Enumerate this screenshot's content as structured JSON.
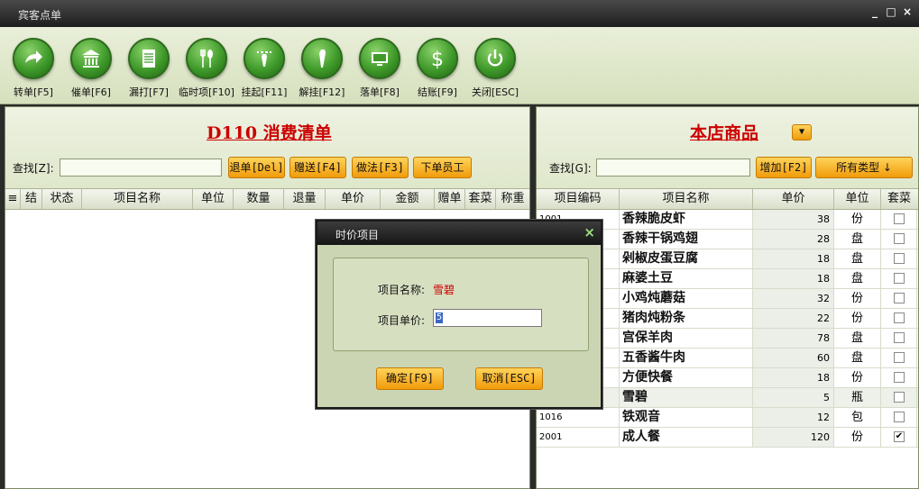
{
  "window": {
    "title": "宾客点单",
    "minimize": "_",
    "maximize": "□",
    "close": "×"
  },
  "toolbar": [
    {
      "label": "转单[F5]",
      "icon": "forward-arrow-icon"
    },
    {
      "label": "催单[F6]",
      "icon": "bank-icon"
    },
    {
      "label": "漏打[F7]",
      "icon": "document-icon"
    },
    {
      "label": "临时项[F10]",
      "icon": "fork-spoon-icon"
    },
    {
      "label": "挂起[F11]",
      "icon": "tie-icon"
    },
    {
      "label": "解挂[F12]",
      "icon": "tie-loose-icon"
    },
    {
      "label": "落单[F8]",
      "icon": "monitor-icon"
    },
    {
      "label": "结账[F9]",
      "icon": "dollar-icon"
    },
    {
      "label": "关闭[ESC]",
      "icon": "power-icon"
    }
  ],
  "left_panel": {
    "title": "D110  消费清单",
    "search_label": "查找[Z]:",
    "search_value": "",
    "buttons": [
      "退单[Del]",
      "赠送[F4]",
      "做法[F3]",
      "下单员工"
    ],
    "columns": [
      "≡",
      "结",
      "状态",
      "项目名称",
      "单位",
      "数量",
      "退量",
      "单价",
      "金额",
      "赠单",
      "套菜",
      "称重"
    ]
  },
  "right_panel": {
    "title": "本店商品",
    "dropdown_icon": "▼",
    "search_label": "查找[G]:",
    "search_value": "",
    "buttons": [
      "增加[F2]",
      "所有类型 ↓"
    ],
    "columns": [
      "项目编码",
      "项目名称",
      "单价",
      "单位",
      "套菜"
    ],
    "rows": [
      {
        "code": "1001",
        "name": "香辣脆皮虾",
        "price": "38",
        "unit": "份",
        "set": false
      },
      {
        "code": "",
        "name": "香辣干锅鸡翅",
        "price": "28",
        "unit": "盘",
        "set": false
      },
      {
        "code": "",
        "name": "剁椒皮蛋豆腐",
        "price": "18",
        "unit": "盘",
        "set": false
      },
      {
        "code": "",
        "name": "麻婆土豆",
        "price": "18",
        "unit": "盘",
        "set": false
      },
      {
        "code": "",
        "name": "小鸡炖蘑菇",
        "price": "32",
        "unit": "份",
        "set": false
      },
      {
        "code": "",
        "name": "猪肉炖粉条",
        "price": "22",
        "unit": "份",
        "set": false
      },
      {
        "code": "",
        "name": "宫保羊肉",
        "price": "78",
        "unit": "盘",
        "set": false
      },
      {
        "code": "",
        "name": "五香酱牛肉",
        "price": "60",
        "unit": "盘",
        "set": false
      },
      {
        "code": "",
        "name": "方便快餐",
        "price": "18",
        "unit": "份",
        "set": false
      },
      {
        "code": "",
        "name": "雪碧",
        "price": "5",
        "unit": "瓶",
        "set": false
      },
      {
        "code": "1016",
        "name": "铁观音",
        "price": "12",
        "unit": "包",
        "set": false
      },
      {
        "code": "2001",
        "name": "成人餐",
        "price": "120",
        "unit": "份",
        "set": true
      }
    ]
  },
  "modal": {
    "title": "时价项目",
    "close": "×",
    "name_label": "项目名称:",
    "name_value": "雪碧",
    "price_label": "项目单价:",
    "price_value": "5",
    "ok_label": "确定[F9]",
    "cancel_label": "取消[ESC]"
  },
  "colors": {
    "accent_red": "#cc0000",
    "button_orange": "#f19b0a",
    "panel_green": "#dfe7cb",
    "annotation_red": "#d9342b"
  }
}
